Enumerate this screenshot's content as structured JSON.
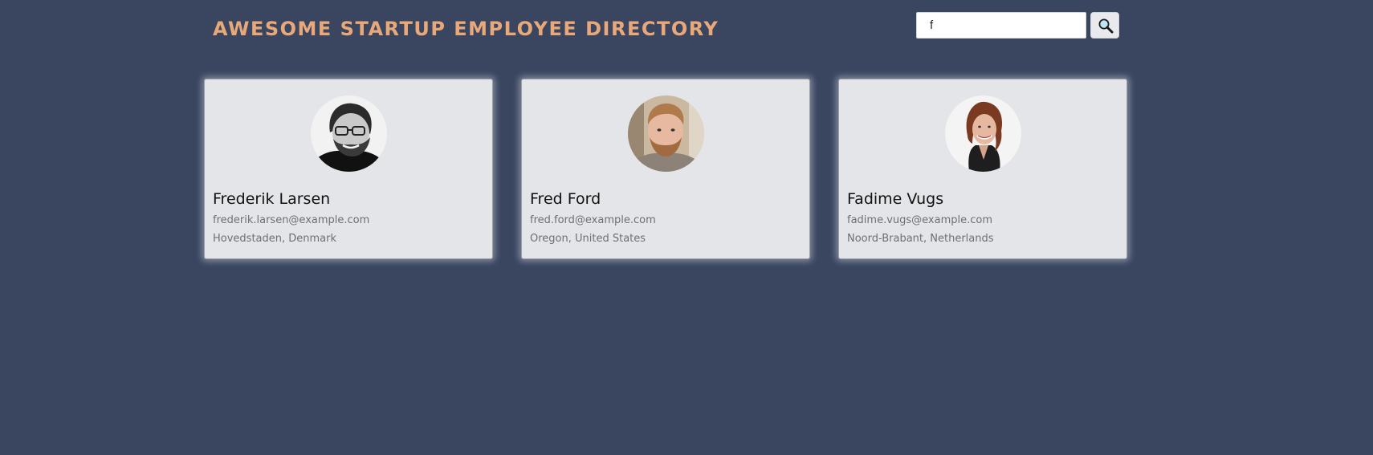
{
  "header": {
    "title": "AWESOME STARTUP EMPLOYEE DIRECTORY"
  },
  "search": {
    "value": "f",
    "button_icon": "search-icon"
  },
  "colors": {
    "background": "#3a4660",
    "title": "#e8a87a",
    "card": "#e4e5e8",
    "muted_text": "#6d6f74"
  },
  "employees": [
    {
      "name": "Frederik Larsen",
      "email": "frederik.larsen@example.com",
      "location": "Hovedstaden, Denmark"
    },
    {
      "name": "Fred Ford",
      "email": "fred.ford@example.com",
      "location": "Oregon, United States"
    },
    {
      "name": "Fadime Vugs",
      "email": "fadime.vugs@example.com",
      "location": "Noord-Brabant, Netherlands"
    }
  ]
}
